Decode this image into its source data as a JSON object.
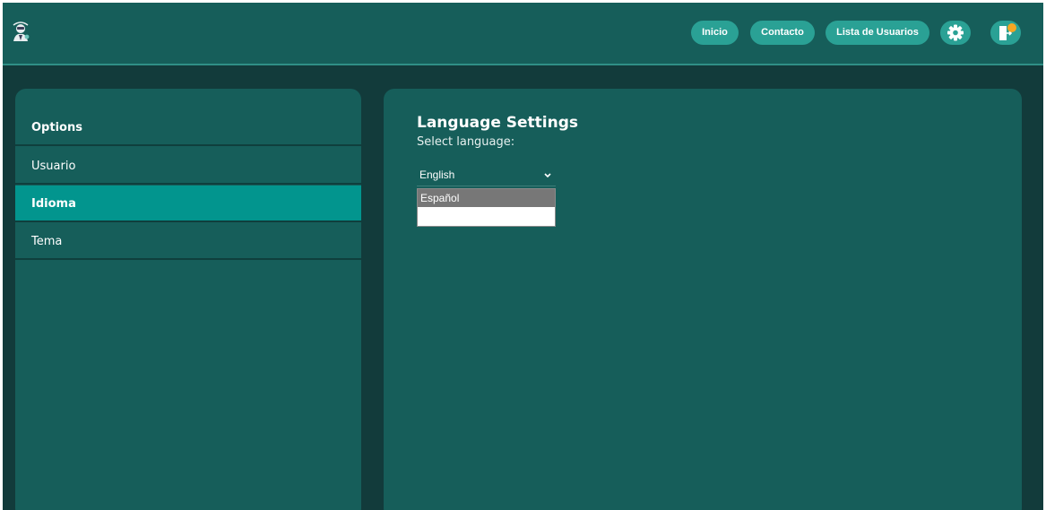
{
  "header": {
    "logo_icon": "user-avatar-icon",
    "nav": [
      {
        "label": "Inicio"
      },
      {
        "label": "Contacto"
      },
      {
        "label": "Lista de Usuarios"
      }
    ],
    "settings_icon": "gear-icon",
    "logout_icon": "door-exit-icon"
  },
  "sidebar": {
    "heading": "Options",
    "items": [
      {
        "label": "Usuario"
      },
      {
        "label": "Idioma",
        "active": true
      },
      {
        "label": "Tema"
      }
    ]
  },
  "main": {
    "title": "Language Settings",
    "subtitle": "Select language:",
    "select": {
      "value": "English",
      "options": [
        "Español"
      ]
    }
  },
  "colors": {
    "background": "#123b3b",
    "panel": "#165e5a",
    "accent": "#2aa195",
    "active_item": "#02958e",
    "badge": "#f5a623"
  }
}
